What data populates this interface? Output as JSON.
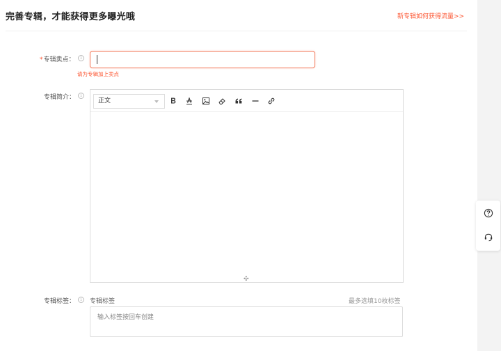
{
  "header": {
    "title": "完善专辑，才能获得更多曝光哦",
    "link": "新专辑如何获得流量>>"
  },
  "form": {
    "selling_point": {
      "label": "专辑卖点：",
      "required_mark": "*",
      "value": "",
      "error": "请为专辑加上卖点"
    },
    "intro": {
      "label": "专辑简介：",
      "format_select": "正文"
    },
    "tags": {
      "label": "专辑标签：",
      "sub_label": "专辑标签",
      "hint": "最多选填10枚标签",
      "placeholder": "输入标签按回车创建"
    },
    "info_icon_char": "i"
  },
  "icons": {
    "toolbar": [
      "bold-icon",
      "strikethrough-icon",
      "image-icon",
      "eraser-icon",
      "quote-icon",
      "horizontal-rule-icon",
      "link-icon"
    ],
    "float": [
      "help-icon",
      "customer-service-icon"
    ]
  },
  "colors": {
    "accent": "#fc5531",
    "input_border_error": "#f37c5e"
  }
}
